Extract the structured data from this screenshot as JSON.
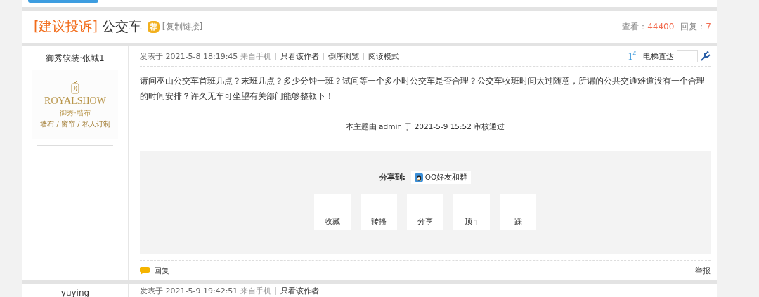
{
  "thread": {
    "category": "[建议投诉]",
    "title": "公交车",
    "badge": "荐",
    "copy_link": "[复制链接]",
    "views_label": "查看：",
    "views": "44400",
    "replies_label": "回复：",
    "replies": "7"
  },
  "posts": [
    {
      "author": "御秀软装·张城1",
      "avatar": {
        "brand": "ROYALSHOW",
        "name": "御秀·墙布",
        "tagline": "墙布 / 窗帘 / 私人订制"
      },
      "posted_label": "发表于",
      "posted_at": "2021-5-8 18:19:45",
      "source": "来自手机",
      "links": [
        "只看该作者",
        "倒序浏览",
        "阅读模式"
      ],
      "floor": "1",
      "floor_mark": "#",
      "jump_label": "电梯直达",
      "body": "请问巫山公交车首班几点？末班几点？多少分钟一班？试问等一个多小时公交车是否合理？公交车收班时间太过随意，所谓的公共交通难道没有一个合理的时间安排？许久无车可坐望有关部门能够整顿下！",
      "moderation": "本主题由 admin 于 2021-5-9 15:52 审核通过",
      "share_label": "分享到:",
      "share_target": "QQ好友和群",
      "actions": [
        {
          "label": "收藏"
        },
        {
          "label": "转播"
        },
        {
          "label": "分享"
        },
        {
          "label": "顶",
          "count": "1"
        },
        {
          "label": "踩"
        }
      ],
      "reply": "回复",
      "report": "举报"
    },
    {
      "author": "yuying",
      "posted_label": "发表于",
      "posted_at": "2021-5-9 19:42:51",
      "source": "来自手机",
      "links": [
        "只看该作者"
      ]
    }
  ]
}
